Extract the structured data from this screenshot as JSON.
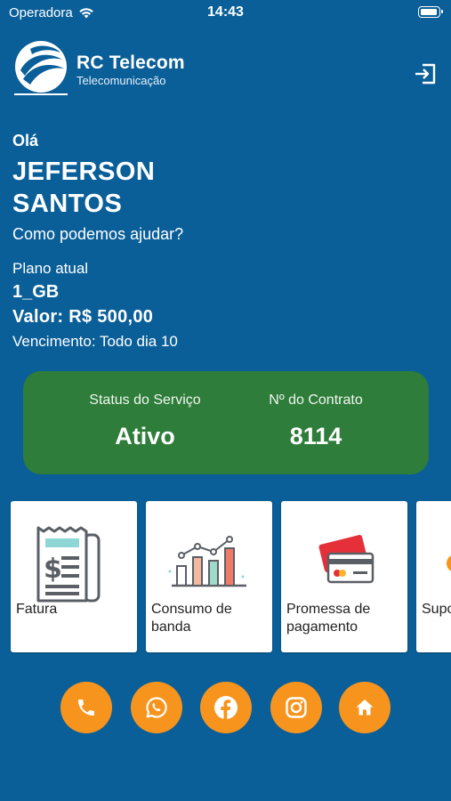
{
  "status_bar": {
    "carrier": "Operadora",
    "time": "14:43"
  },
  "header": {
    "brand_name": "RC Telecom",
    "brand_sub": "Telecomunicação",
    "logout_icon": "logout-icon"
  },
  "greeting": {
    "hello": "Olá",
    "user_name": "JEFERSON SANTOS",
    "help_text": "Como podemos ajudar?"
  },
  "plan": {
    "label": "Plano atual",
    "name": "1_GB",
    "value": "Valor: R$ 500,00",
    "due": "Vencimento: Todo dia 10"
  },
  "status_card": {
    "status_label": "Status do Serviço",
    "status_value": "Ativo",
    "contract_label": "Nº do Contrato",
    "contract_value": "8114",
    "color": "#2e7d3a"
  },
  "cards": [
    {
      "label": "Fatura",
      "icon": "invoice-icon"
    },
    {
      "label": "Consumo de banda",
      "icon": "bandwidth-chart-icon"
    },
    {
      "label": "Promessa de pagamento",
      "icon": "payment-cards-icon"
    },
    {
      "label": "Suporte",
      "icon": "support-icon"
    }
  ],
  "social_buttons": [
    {
      "icon": "phone-icon"
    },
    {
      "icon": "whatsapp-icon"
    },
    {
      "icon": "facebook-icon"
    },
    {
      "icon": "instagram-icon"
    },
    {
      "icon": "home-icon"
    }
  ],
  "colors": {
    "background": "#0a5f99",
    "accent": "#f7941d",
    "card": "#ffffff"
  }
}
